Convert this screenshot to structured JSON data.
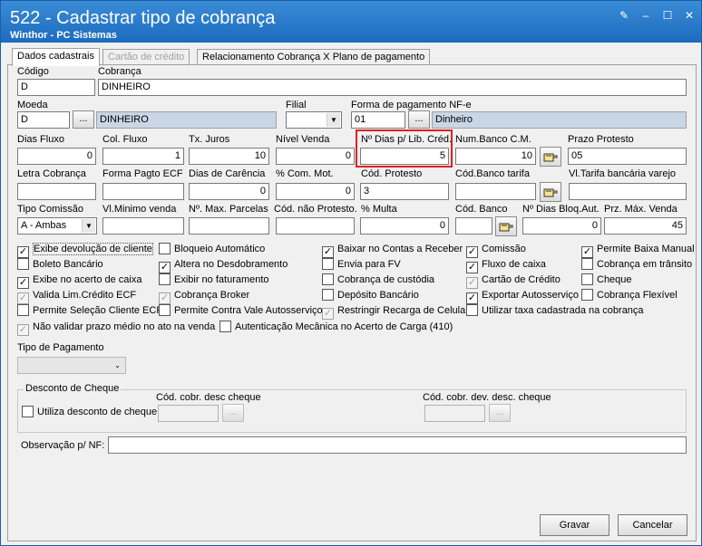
{
  "window": {
    "title": "522 - Cadastrar tipo de cobrança",
    "subtitle": "Winthor - PC Sistemas"
  },
  "tabs": [
    {
      "label": "Dados cadastrais"
    },
    {
      "label": "Cartão de crédito"
    },
    {
      "label": "Relacionamento Cobrança X Plano de pagamento"
    }
  ],
  "fields": {
    "codigo": {
      "label": "Código",
      "value": "D"
    },
    "cobranca": {
      "label": "Cobrança",
      "value": "DINHEIRO"
    },
    "moeda": {
      "label": "Moeda",
      "value": "D",
      "desc": "DINHEIRO"
    },
    "filial": {
      "label": "Filial",
      "value": ""
    },
    "forma_pag_nfe": {
      "label": "Forma de pagamento NF-e",
      "value": "01",
      "desc": "Dinheiro"
    },
    "dias_fluxo": {
      "label": "Dias Fluxo",
      "value": "0"
    },
    "col_fluxo": {
      "label": "Col. Fluxo",
      "value": "1"
    },
    "tx_juros": {
      "label": "Tx. Juros",
      "value": "10"
    },
    "nivel_venda": {
      "label": "Nível Venda",
      "value": "0"
    },
    "dias_lib_cred": {
      "label": "Nº Dias p/ Lib. Créd.",
      "value": "5"
    },
    "num_banco_cm": {
      "label": "Num.Banco C.M.",
      "value": "10"
    },
    "prazo_protesto": {
      "label": "Prazo Protesto",
      "value": "05"
    },
    "letra_cobranca": {
      "label": "Letra Cobrança",
      "value": ""
    },
    "forma_pagto_ecf": {
      "label": "Forma Pagto ECF",
      "value": ""
    },
    "dias_carencia": {
      "label": "Dias de Carência",
      "value": "0"
    },
    "com_mot": {
      "label": "% Com. Mot.",
      "value": "0"
    },
    "cod_protesto": {
      "label": "Cód. Protesto",
      "value": "3"
    },
    "cod_banco_tarifa": {
      "label": "Cód.Banco tarifa",
      "value": ""
    },
    "vl_tarifa": {
      "label": "Vl.Tarifa bancária varejo",
      "value": ""
    },
    "tipo_comissao": {
      "label": "Tipo Comissão",
      "value": "A - Ambas"
    },
    "vl_minimo_venda": {
      "label": "Vl.Minimo venda",
      "value": ""
    },
    "max_parcelas": {
      "label": "Nº. Max. Parcelas",
      "value": ""
    },
    "cod_nao_protesto": {
      "label": "Cód. não Protesto.",
      "value": ""
    },
    "multa": {
      "label": "% Multa",
      "value": "0"
    },
    "cod_banco": {
      "label": "Cód. Banco",
      "value": ""
    },
    "dias_bloq_aut": {
      "label": "Nº Dias Bloq.Aut.",
      "value": "0"
    },
    "prz_max_venda": {
      "label": "Prz. Máx. Venda",
      "value": "45"
    }
  },
  "checkboxes": [
    {
      "label": "Exibe devolução de cliente",
      "checked": true,
      "disabled": false
    },
    {
      "label": "Boleto Bancário",
      "checked": false,
      "disabled": false
    },
    {
      "label": "Exibe no acerto de caixa",
      "checked": true,
      "disabled": false
    },
    {
      "label": "Valida Lim.Crédito ECF",
      "checked": true,
      "disabled": true
    },
    {
      "label": "Permite Seleção Cliente ECF",
      "checked": false,
      "disabled": false
    },
    {
      "label": "Não validar prazo médio no ato na venda",
      "checked": true,
      "disabled": true
    },
    {
      "label": "Bloqueio Automático",
      "checked": false,
      "disabled": false
    },
    {
      "label": "Altera no Desdobramento",
      "checked": true,
      "disabled": false
    },
    {
      "label": "Exibir no faturamento",
      "checked": false,
      "disabled": false
    },
    {
      "label": "Cobrança Broker",
      "checked": true,
      "disabled": true
    },
    {
      "label": "Permite Contra Vale Autosserviço",
      "checked": false,
      "disabled": false
    },
    {
      "label": "Autenticação Mecânica no Acerto de Carga (410)",
      "checked": false,
      "disabled": false
    },
    {
      "label": "Baixar no Contas a Receber",
      "checked": true,
      "disabled": false
    },
    {
      "label": "Envia para FV",
      "checked": false,
      "disabled": false
    },
    {
      "label": "Cobrança de custódia",
      "checked": false,
      "disabled": false
    },
    {
      "label": "Depósito Bancário",
      "checked": false,
      "disabled": false
    },
    {
      "label": "Restringir Recarga de Celular",
      "checked": true,
      "disabled": true
    },
    {
      "label": "Comissão",
      "checked": true,
      "disabled": false
    },
    {
      "label": "Fluxo de caixa",
      "checked": true,
      "disabled": false
    },
    {
      "label": "Cartão de Crédito",
      "checked": true,
      "disabled": true
    },
    {
      "label": "Exportar Autosserviço",
      "checked": true,
      "disabled": false
    },
    {
      "label": "Utilizar taxa cadastrada na cobrança",
      "checked": false,
      "disabled": false
    },
    {
      "label": "Permite Baixa Manual",
      "checked": true,
      "disabled": false
    },
    {
      "label": "Cobrança em trânsito",
      "checked": false,
      "disabled": false
    },
    {
      "label": "Cheque",
      "checked": false,
      "disabled": false
    },
    {
      "label": "Cobrança Flexível",
      "checked": false,
      "disabled": false
    }
  ],
  "tipo_pagamento": {
    "label": "Tipo de Pagamento",
    "value": ""
  },
  "desconto_cheque": {
    "title": "Desconto de Cheque",
    "utiliza_label": "Utiliza desconto de cheque",
    "cod_desc_label": "Cód. cobr. desc cheque",
    "cod_dev_label": "Cód. cobr. dev. desc. cheque"
  },
  "observacao": {
    "label": "Observação p/ NF:",
    "value": ""
  },
  "buttons": {
    "ellipsis": "...",
    "save": "Gravar",
    "cancel": "Cancelar"
  },
  "colors": {
    "titlebar": "#1c6bbf",
    "highlight": "#e02020"
  }
}
